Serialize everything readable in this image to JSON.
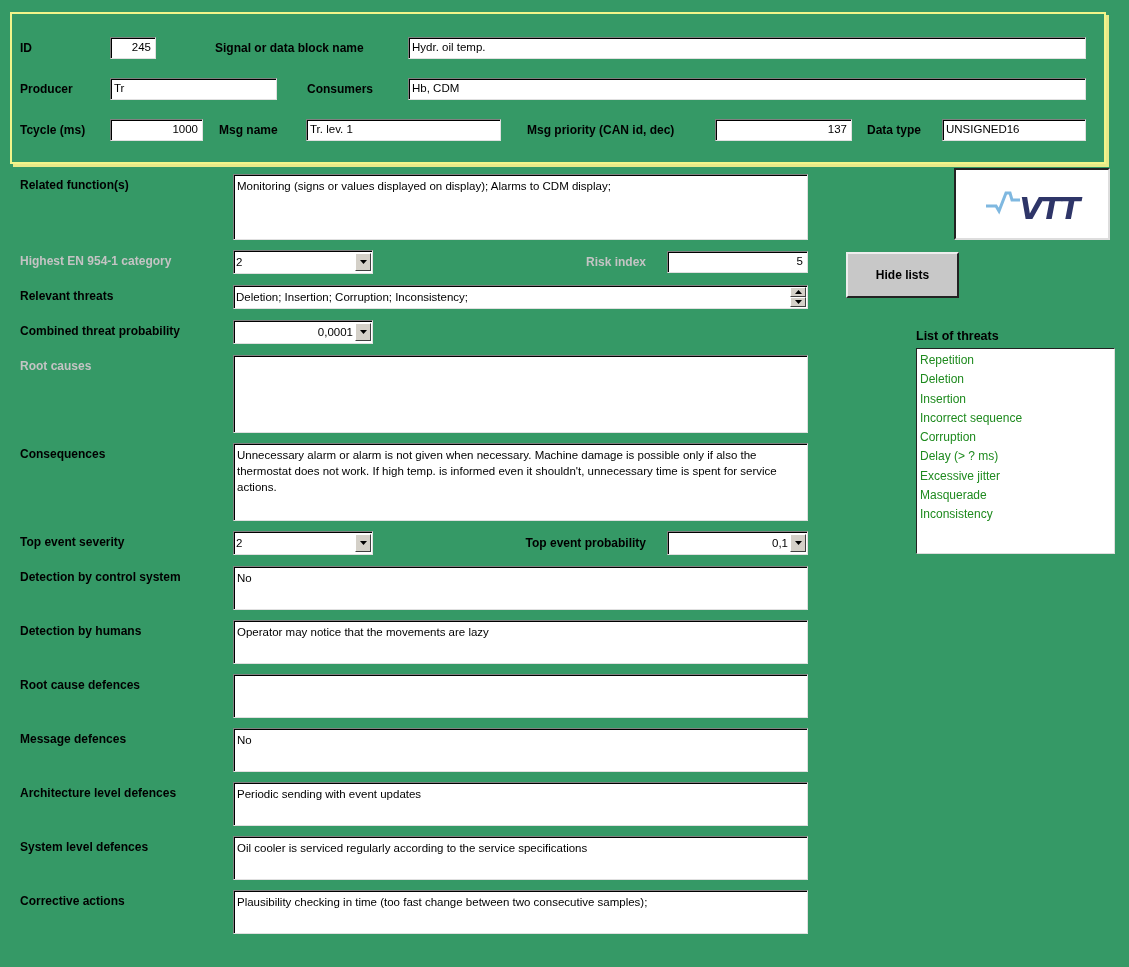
{
  "header": {
    "rows": [
      [
        {
          "label": "ID",
          "value": "245",
          "kind": "number"
        },
        {
          "label": "Signal or data block name",
          "value": "Hydr. oil temp.",
          "kind": "text"
        }
      ],
      [
        {
          "label": "Producer",
          "value": "Tr",
          "kind": "text"
        },
        {
          "label": "Consumers",
          "value": "Hb, CDM",
          "kind": "text"
        }
      ],
      [
        {
          "label": "Tcycle (ms)",
          "value": "1000",
          "kind": "number"
        },
        {
          "label": "Msg name",
          "value": "Tr. lev. 1",
          "kind": "text"
        },
        {
          "label": "Msg priority (CAN id, dec)",
          "value": "137",
          "kind": "number"
        },
        {
          "label": "Data type",
          "value": "UNSIGNED16",
          "kind": "text"
        }
      ]
    ]
  },
  "rows": [
    {
      "label": "Related function(s)",
      "disabled": false,
      "kind": "bigmemo",
      "value": "Monitoring (signs or values displayed on display);  Alarms to CDM display;"
    },
    {
      "label": "Highest EN 954-1 category",
      "disabled": true,
      "kind": "combo",
      "value": "2",
      "right": {
        "label": "Risk index",
        "disabled": true,
        "kind": "number",
        "value": "5"
      }
    },
    {
      "label": "Relevant threats",
      "disabled": false,
      "kind": "spin",
      "value": "Deletion; Insertion; Corruption; Inconsistency;"
    },
    {
      "label": "Combined threat probability",
      "disabled": false,
      "kind": "numcombo",
      "value": "0,0001"
    },
    {
      "label": "Root causes",
      "disabled": true,
      "kind": "bigmemo"
    },
    {
      "label": "Consequences",
      "disabled": false,
      "kind": "bigmemo",
      "value": "Unnecessary alarm or alarm is not given when necessary. Machine damage is possible only if also the thermostat does not work. If high temp. is informed even it shouldn't, unnecessary time is spent for service actions."
    },
    {
      "label": "Top event severity",
      "disabled": false,
      "kind": "combo",
      "value": "2",
      "right": {
        "label": "Top event probability",
        "disabled": false,
        "kind": "numcombo",
        "value": "0,1"
      }
    },
    {
      "label": "Detection by control system",
      "disabled": false,
      "kind": "memo",
      "value": "No"
    },
    {
      "label": "Detection by humans",
      "disabled": false,
      "kind": "memo",
      "value": "Operator may notice that the movements are lazy"
    },
    {
      "label": "Root cause defences",
      "disabled": false,
      "kind": "memo"
    },
    {
      "label": "Message defences",
      "disabled": false,
      "kind": "memo",
      "value": "No"
    },
    {
      "label": "Architecture level defences",
      "disabled": false,
      "kind": "memo",
      "value": "Periodic sending with event updates"
    },
    {
      "label": "System level defences",
      "disabled": false,
      "kind": "memo",
      "value": "Oil cooler is serviced regularly according to the service specifications"
    },
    {
      "label": "Corrective actions",
      "disabled": false,
      "kind": "memo",
      "value": "Plausibility checking in time (too fast change between two consecutive samples);"
    }
  ],
  "logo": {
    "text": "VTT"
  },
  "hide_button": "Hide lists",
  "threat_list": {
    "title": "List of threats",
    "items": [
      "Repetition",
      "Deletion",
      "Insertion",
      "Incorrect sequence",
      "Corruption",
      "Delay (> ? ms)",
      "Excessive jitter",
      "Masquerade",
      "Inconsistency"
    ]
  }
}
